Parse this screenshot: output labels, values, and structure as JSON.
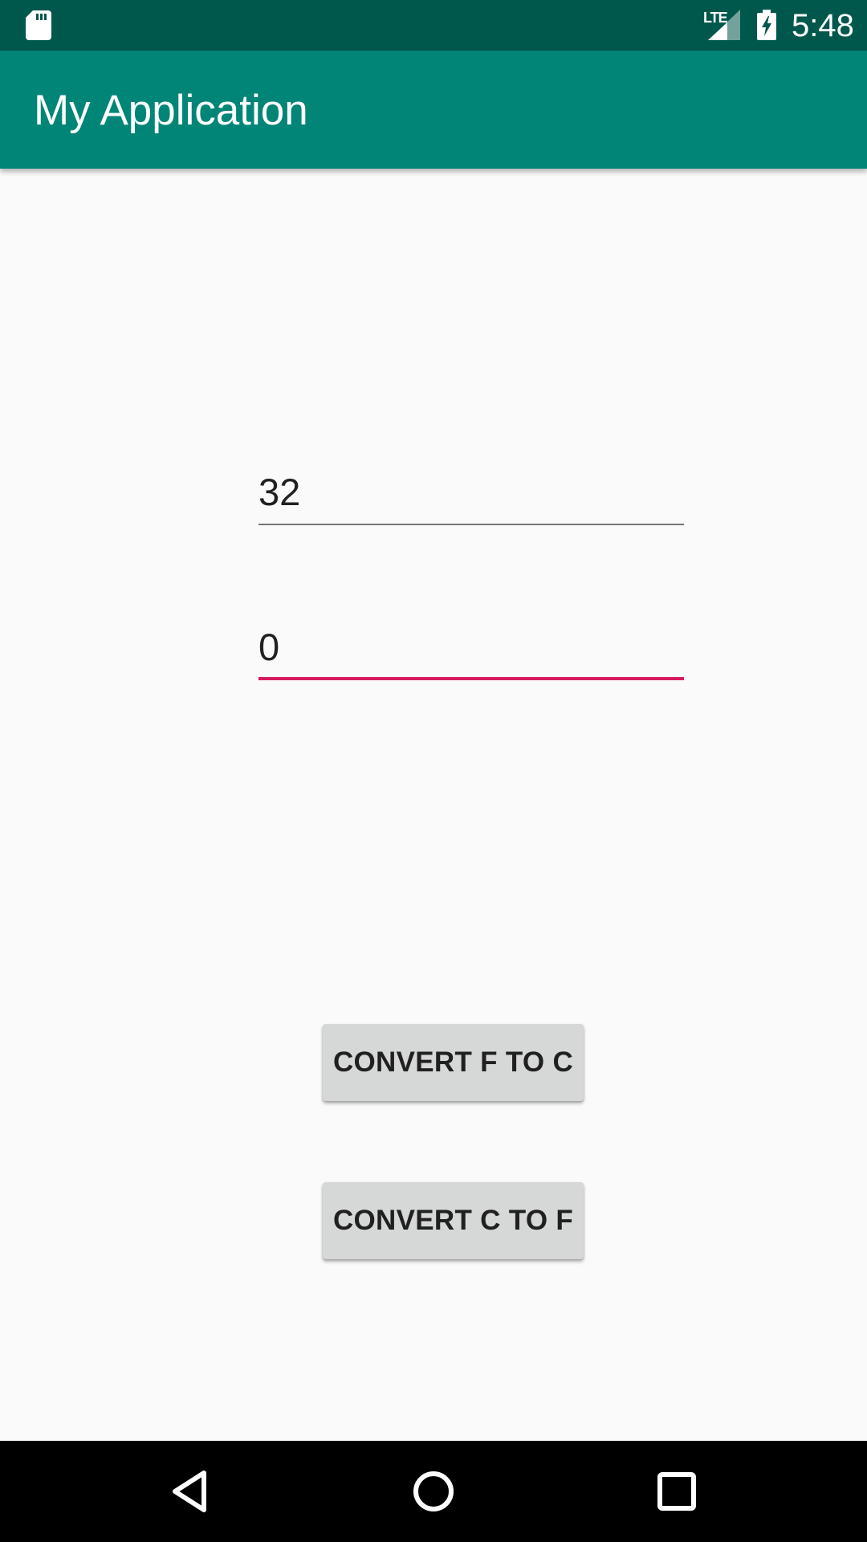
{
  "status_bar": {
    "network_label": "LTE",
    "time": "5:48",
    "icons": [
      "sd-card-icon",
      "signal-icon",
      "battery-charging-icon"
    ]
  },
  "app_bar": {
    "title": "My Application"
  },
  "fahrenheit_input": {
    "value": "32"
  },
  "celsius_input": {
    "value": "0",
    "focused": true
  },
  "buttons": {
    "f_to_c": "CONVERT F TO C",
    "c_to_f": "CONVERT C TO F"
  },
  "navigation": {
    "icons": [
      "back-icon",
      "home-icon",
      "recents-icon"
    ]
  },
  "colors": {
    "status_bar": "#00574b",
    "app_bar": "#008577",
    "accent": "#d81b60",
    "background": "#fafafa",
    "button": "#d6d7d7"
  }
}
